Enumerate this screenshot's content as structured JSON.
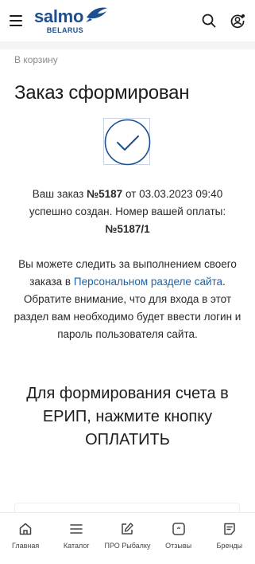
{
  "header": {
    "logo_main": "salmo",
    "logo_sub": "BELARUS",
    "brand_color": "#1d4e8f",
    "icons": [
      "menu-icon",
      "search-icon",
      "user-settings-icon"
    ]
  },
  "breadcrumb": {
    "back_label": "В корзину"
  },
  "page": {
    "title": "Заказ сформирован"
  },
  "order": {
    "prefix": "Ваш заказ",
    "number": "№5187",
    "date_text": "от 03.03.2023 09:40",
    "created_text": "успешно создан. Номер вашей оплаты:",
    "payment_number": "№5187/1"
  },
  "info": {
    "text_before": "Вы можете следить за выполнением своего заказа в",
    "link_text": "Персональном разделе сайта",
    "text_after": ". Обратите внимание, что для входа в этот раздел вам необходимо будет ввести логин и пароль пользователя сайта.",
    "link_color": "#1d63a8"
  },
  "erip": {
    "text": "Для формирования счета в ЕРИП, нажмите кнопку ОПЛАТИТЬ"
  },
  "bottom_nav": {
    "items": [
      {
        "label": "Главная",
        "icon": "home-icon"
      },
      {
        "label": "Каталог",
        "icon": "catalog-icon"
      },
      {
        "label": "ПРО Рыбалку",
        "icon": "edit-icon"
      },
      {
        "label": "Отзывы",
        "icon": "reviews-icon"
      },
      {
        "label": "Бренды",
        "icon": "brands-icon"
      }
    ]
  }
}
